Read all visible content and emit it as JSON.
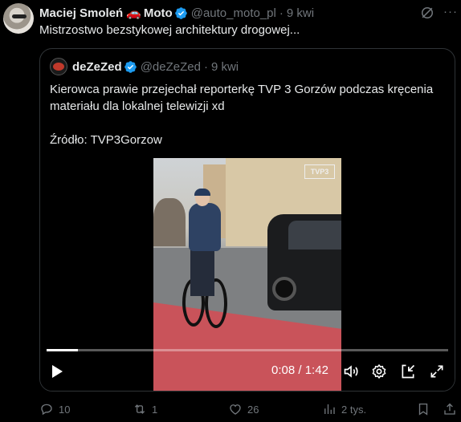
{
  "tweet": {
    "author_name": "Maciej Smoleń",
    "author_emoji": "🚗",
    "author_suffix": "Moto",
    "handle": "@auto_moto_pl",
    "separator": "·",
    "time": "9 kwi",
    "text": "Mistrzostwo bezstykowej architektury drogowej..."
  },
  "quote": {
    "author_name": "deZeZed",
    "handle": "@deZeZed",
    "separator": "·",
    "time": "9 kwi",
    "text_line1": "Kierowca prawie przejechał reporterkę TVP 3 Gorzów podczas kręcenia materiału dla lokalnej telewizji xd",
    "text_line2": "Źródło: TVP3Gorzow",
    "video": {
      "channel_logo": "TVP3",
      "current_time": "0:08",
      "time_separator": "/",
      "duration": "1:42",
      "progress": 0.078
    }
  },
  "actions": {
    "replies": "10",
    "retweets": "1",
    "likes": "26",
    "views": "2 tys."
  },
  "colors": {
    "background": "#000000",
    "text": "#e7e9ea",
    "muted": "#71767b",
    "verified": "#1d9bf0",
    "border": "#2f3336"
  }
}
